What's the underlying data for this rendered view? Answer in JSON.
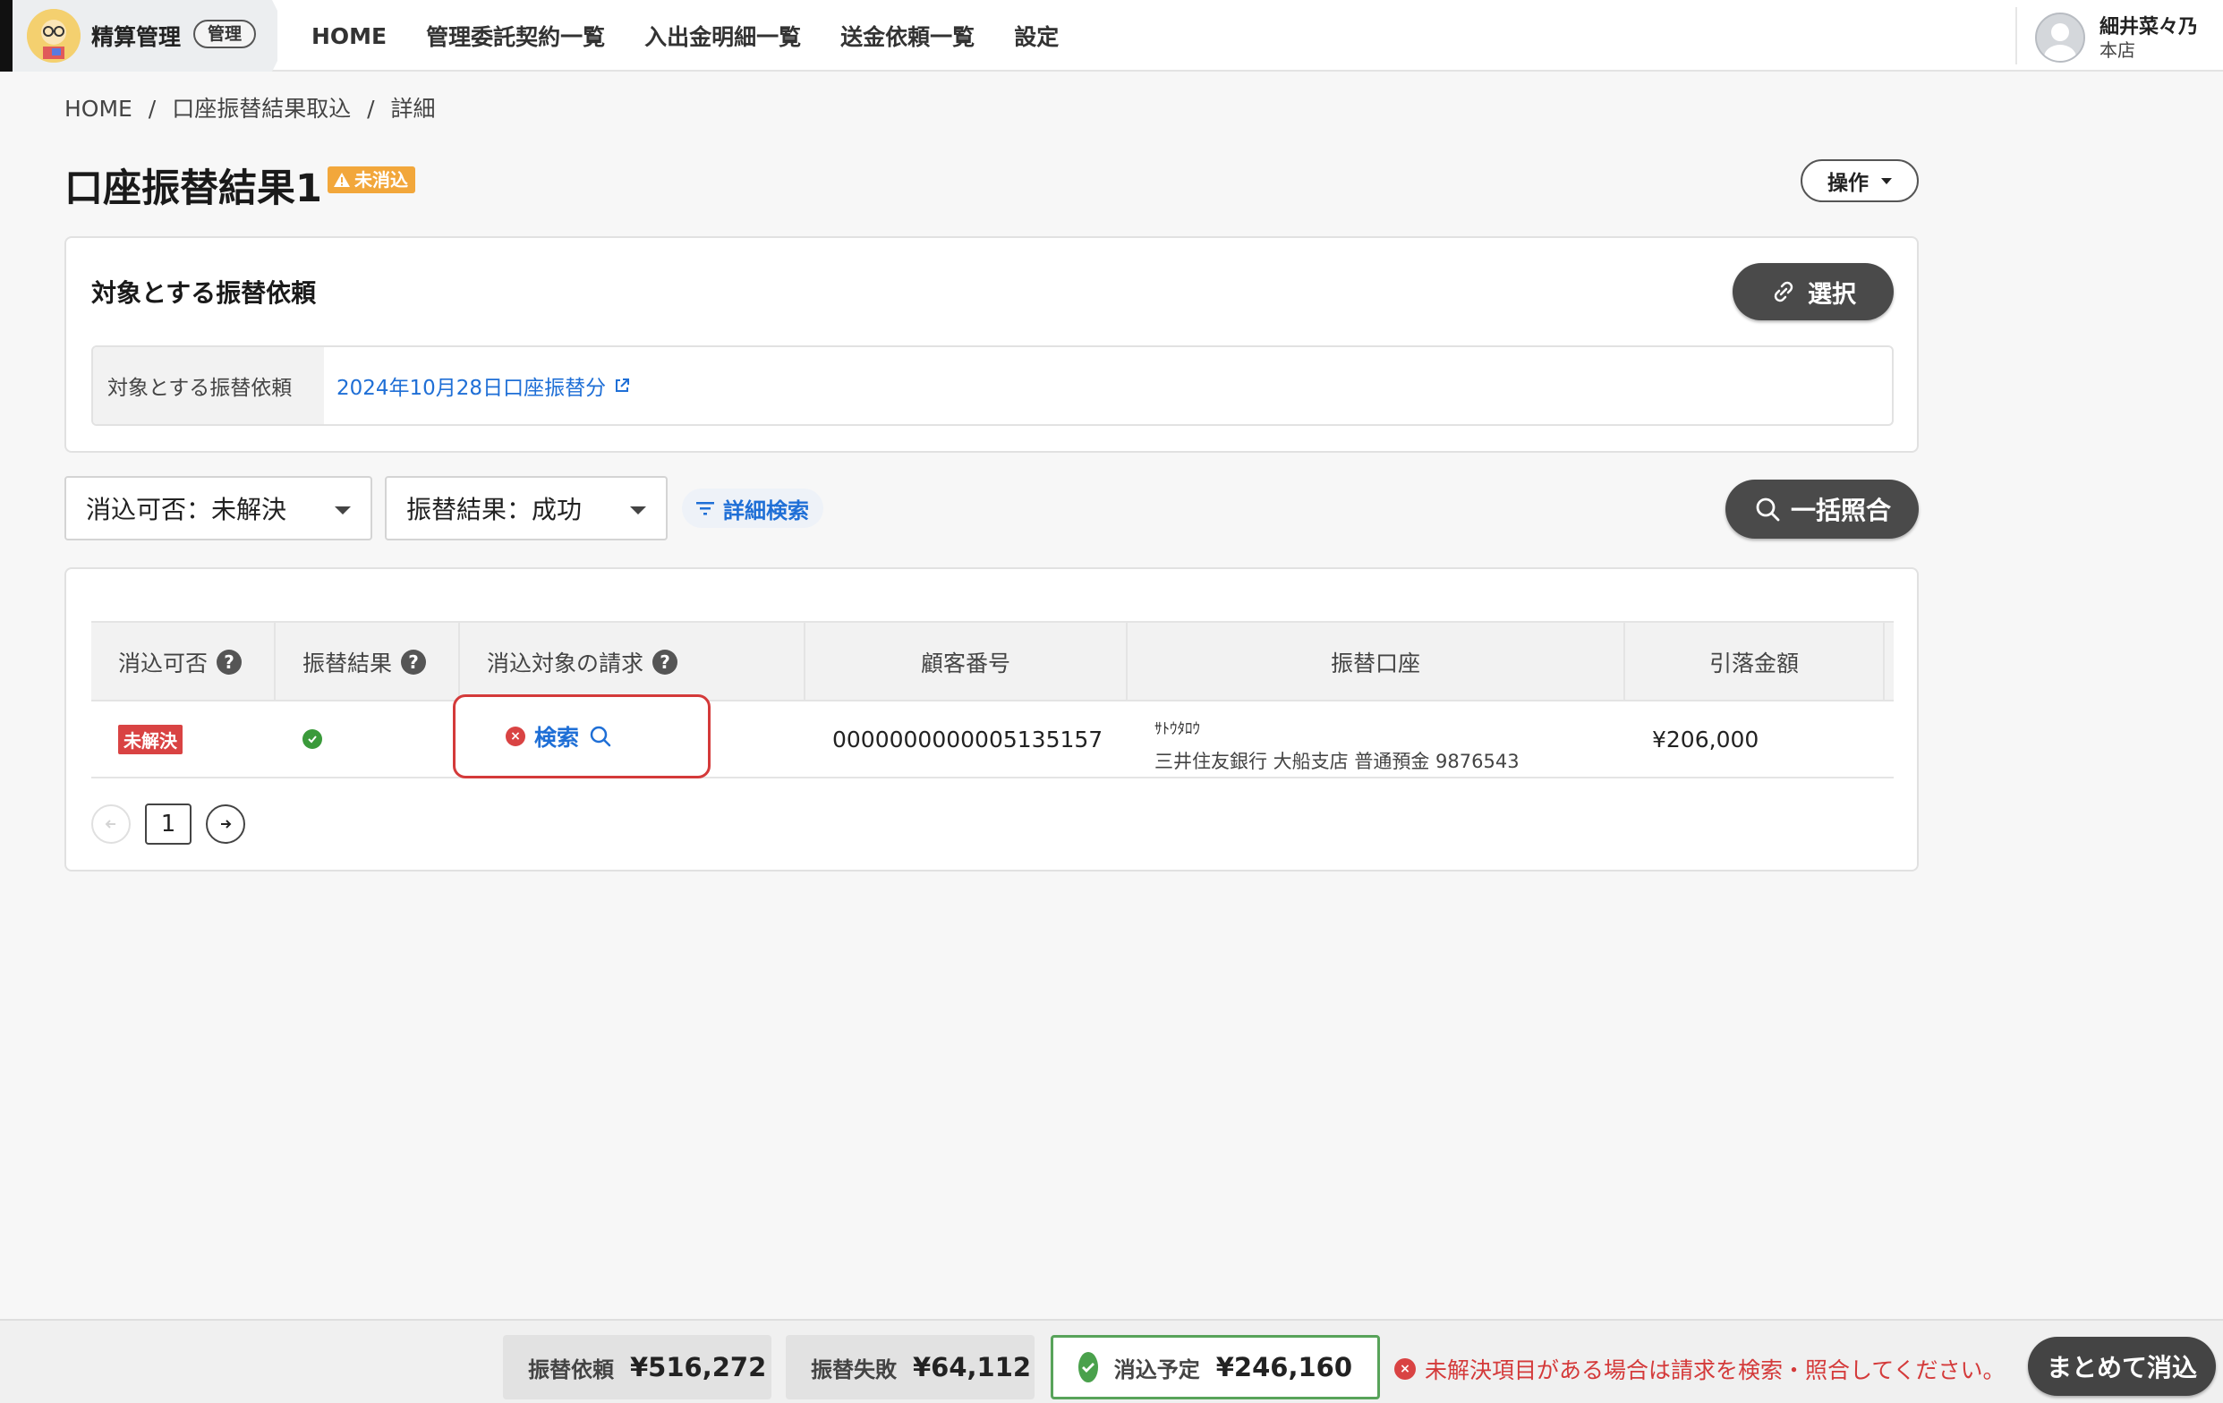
{
  "header": {
    "brand_title": "精算管理",
    "brand_badge": "管理",
    "nav": [
      "HOME",
      "管理委託契約一覧",
      "入出金明細一覧",
      "送金依頼一覧",
      "設定"
    ],
    "user_name": "細井菜々乃",
    "user_branch": "本店"
  },
  "breadcrumb": [
    "HOME",
    "/",
    "口座振替結果取込",
    "/",
    "詳細"
  ],
  "page": {
    "title": "口座振替結果1",
    "status_badge": "未消込",
    "ops_label": "操作"
  },
  "target_card": {
    "title": "対象とする振替依頼",
    "select_label": "選択",
    "field_label": "対象とする振替依頼",
    "field_value": "2024年10月28日口座振替分"
  },
  "filters": {
    "filter1": "消込可否：未解決",
    "filter2": "振替結果：成功",
    "advanced": "詳細検索",
    "bulk_label": "一括照合"
  },
  "table": {
    "columns": [
      "消込可否",
      "振替結果",
      "消込対象の請求",
      "顧客番号",
      "振替口座",
      "引落金額"
    ],
    "rows": [
      {
        "status": "未解決",
        "search_label": "検索",
        "customer_no": "0000000000005135157",
        "account_kana": "ｻﾄｳﾀﾛｳ",
        "account_bank": "三井住友銀行 大船支店 普通預金 9876543",
        "amount": "¥206,000"
      }
    ],
    "page": "1"
  },
  "footer": {
    "sum1_label": "振替依頼",
    "sum1_value": "¥516,272",
    "sum2_label": "振替失敗",
    "sum2_value": "¥64,112",
    "sum3_label": "消込予定",
    "sum3_value": "¥246,160",
    "message": "未解決項目がある場合は請求を検索・照合してください。",
    "consolidate_label": "まとめて消込"
  }
}
